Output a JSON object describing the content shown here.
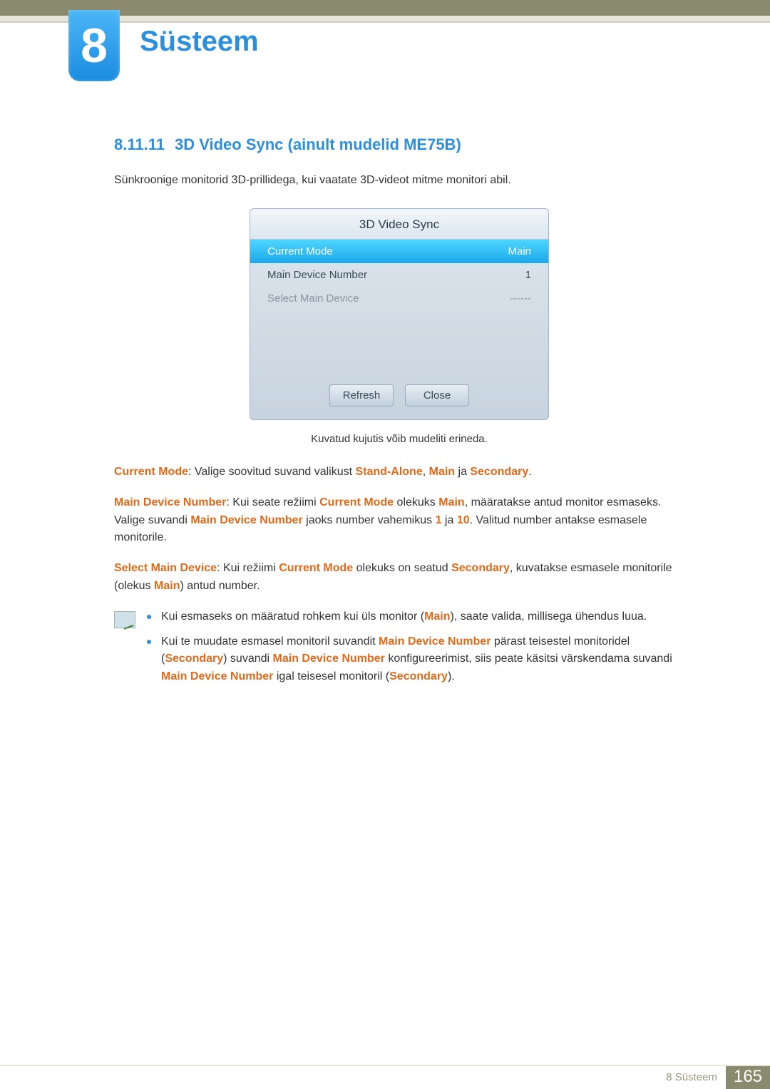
{
  "chapter": {
    "number": "8",
    "title": "Süsteem"
  },
  "section": {
    "number": "8.11.11",
    "title": "3D Video Sync (ainult mudelid ME75B)",
    "intro": "Sünkroonige monitorid 3D-prillidega, kui vaatate 3D-videot mitme monitori abil."
  },
  "osd": {
    "title": "3D Video Sync",
    "rows": [
      {
        "label": "Current Mode",
        "value": "Main",
        "state": "selected"
      },
      {
        "label": "Main Device Number",
        "value": "1",
        "state": "normal"
      },
      {
        "label": "Select Main Device",
        "value": "------",
        "state": "disabled"
      }
    ],
    "buttons": {
      "refresh": "Refresh",
      "close": "Close"
    }
  },
  "caption": "Kuvatud kujutis võib mudeliti erineda.",
  "para1": {
    "k1": "Current Mode",
    "t1": ": Valige soovitud suvand valikust ",
    "k2": "Stand-Alone",
    "t2": ", ",
    "k3": "Main",
    "t3": " ja ",
    "k4": "Secondary",
    "t4": "."
  },
  "para2": {
    "k1": "Main Device Number",
    "t1": ": Kui seate režiimi ",
    "k2": "Current Mode",
    "t2": " olekuks ",
    "k3": "Main",
    "t3": ", määratakse antud monitor esmaseks. Valige suvandi ",
    "k4": "Main Device Number",
    "t4": " jaoks number vahemikus ",
    "k5": "1",
    "t5": " ja ",
    "k6": "10",
    "t6": ". Valitud number antakse esmasele monitorile."
  },
  "para3": {
    "k1": "Select Main Device",
    "t1": ": Kui režiimi ",
    "k2": "Current Mode",
    "t2": " olekuks on seatud ",
    "k3": "Secondary",
    "t3": ", kuvatakse esmasele monitorile (olekus ",
    "k4": "Main",
    "t4": ") antud number."
  },
  "note1": {
    "t1": "Kui esmaseks on määratud rohkem kui üls monitor (",
    "k1": "Main",
    "t2": "), saate valida, millisega ühendus luua."
  },
  "note2": {
    "t1": "Kui te muudate esmasel monitoril suvandit ",
    "k1": "Main Device Number",
    "t2": " pärast teisestel monitoridel (",
    "k2": "Secondary",
    "t3": ") suvandi ",
    "k3": "Main Device Number",
    "t4": " konfigureerimist, siis peate käsitsi värskendama suvandi ",
    "k4": "Main Device Number",
    "t5": " igal teisesel monitoril (",
    "k5": "Secondary",
    "t6": ")."
  },
  "footer": {
    "crumb": "8 Süsteem",
    "page": "165"
  }
}
